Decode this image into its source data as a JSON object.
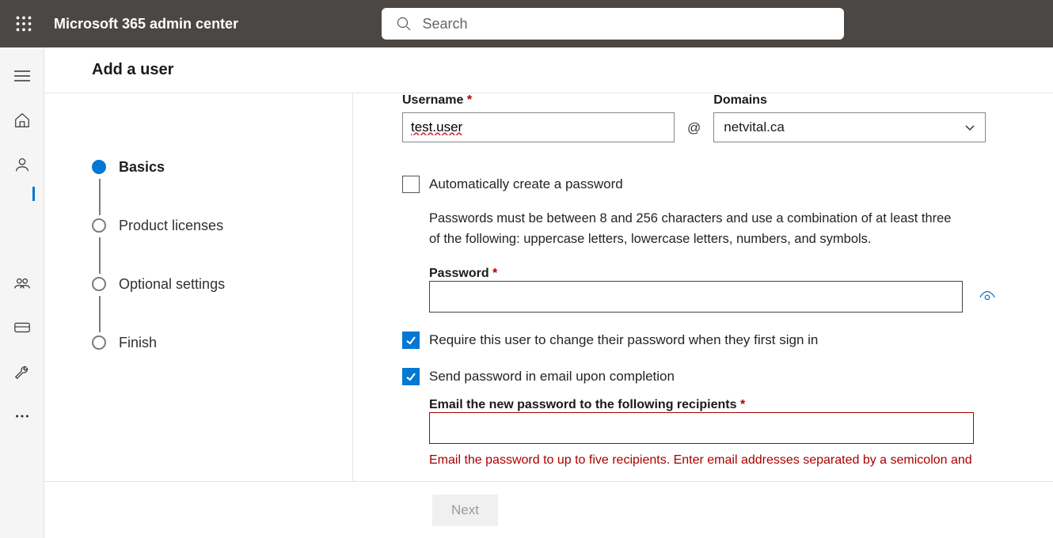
{
  "header": {
    "app_title": "Microsoft 365 admin center",
    "search_placeholder": "Search"
  },
  "panel": {
    "title": "Add a user",
    "wizard_steps": [
      {
        "label": "Basics",
        "current": true
      },
      {
        "label": "Product licenses",
        "current": false
      },
      {
        "label": "Optional settings",
        "current": false
      },
      {
        "label": "Finish",
        "current": false
      }
    ],
    "form": {
      "username_label": "Username",
      "username_value": "test.user",
      "domains_label": "Domains",
      "domain_selected": "netvital.ca",
      "at_symbol": "@",
      "auto_create_label": "Automatically create a password",
      "auto_create_checked": false,
      "password_help": "Passwords must be between 8 and 256 characters and use a combination of at least three of the following: uppercase letters, lowercase letters, numbers, and symbols.",
      "password_label": "Password",
      "password_value": "",
      "require_change_label": "Require this user to change their password when they first sign in",
      "require_change_checked": true,
      "send_email_label": "Send password in email upon completion",
      "send_email_checked": true,
      "email_recipients_label": "Email the new password to the following recipients",
      "email_recipients_value": "",
      "email_error": "Email the password to up to five recipients. Enter email addresses separated by a semicolon and"
    },
    "footer": {
      "next_label": "Next"
    }
  },
  "rail_icons": [
    "menu",
    "home",
    "user",
    "group",
    "billing",
    "setup",
    "more"
  ]
}
